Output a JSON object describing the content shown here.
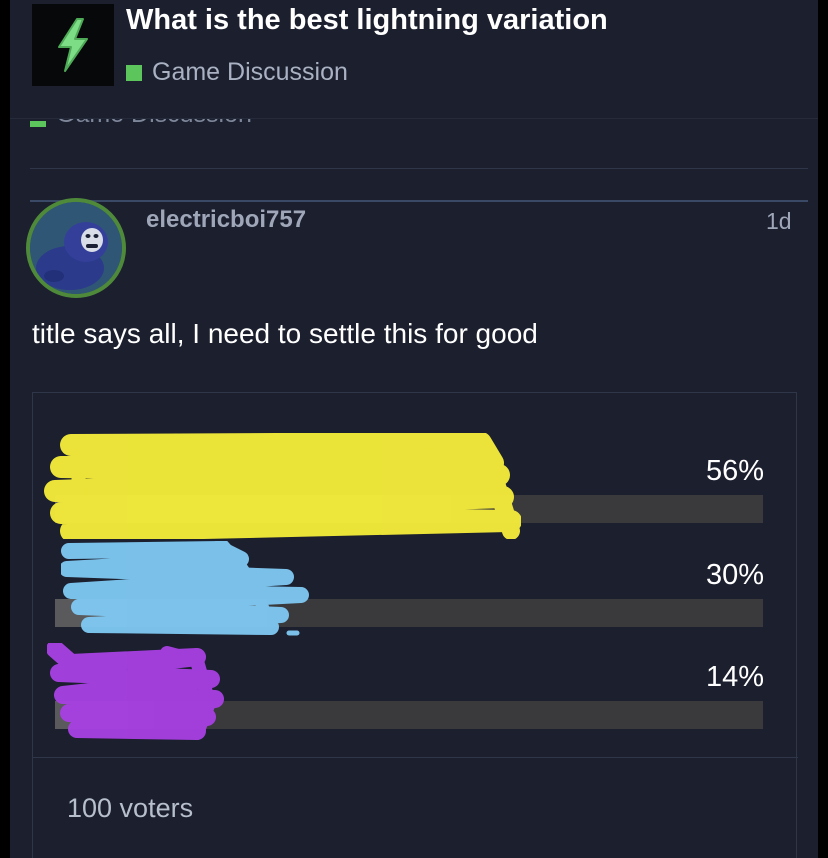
{
  "topic": {
    "title": "What is the best lightning variation",
    "category": "Game Discussion",
    "category_color": "#5cc65c",
    "logo_icon": "lightning-bolt-icon"
  },
  "post": {
    "username": "electricboi757",
    "age": "1d",
    "body": "title says all, I need to settle this for good",
    "avatar": "gorilla-avatar"
  },
  "poll": {
    "options": [
      {
        "label": "",
        "percent_text": "56%",
        "percent": 56,
        "scribble_color": "#f2ea3a"
      },
      {
        "label": "",
        "percent_text": "30%",
        "percent": 30,
        "scribble_color": "#7ec6f0"
      },
      {
        "label": "",
        "percent_text": "14%",
        "percent": 14,
        "scribble_color": "#a640e0"
      }
    ],
    "voters": "100 voters"
  }
}
